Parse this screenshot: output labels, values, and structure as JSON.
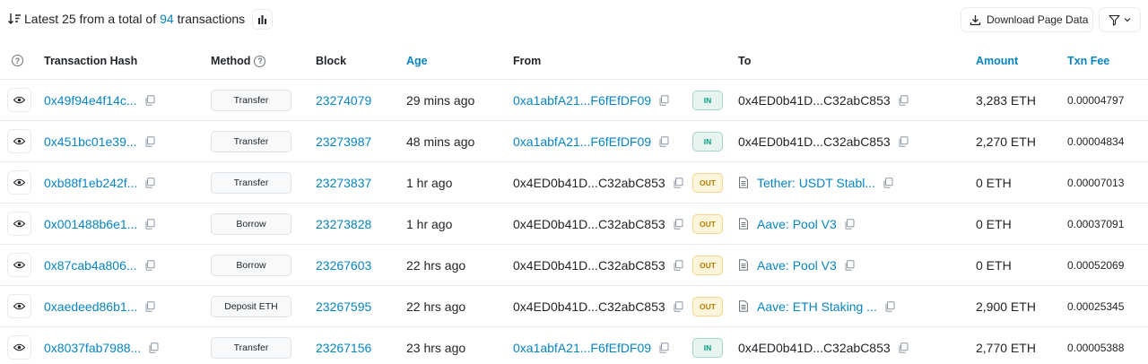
{
  "summary": {
    "prefix": "Latest 25 from a total of",
    "count": "94",
    "suffix": "transactions"
  },
  "toolbar": {
    "download_label": "Download Page Data"
  },
  "columns": {
    "hash": "Transaction Hash",
    "method": "Method",
    "block": "Block",
    "age": "Age",
    "from": "From",
    "to": "To",
    "amount": "Amount",
    "fee": "Txn Fee"
  },
  "colors": {
    "link": "#0784c3",
    "in_bg": "#e8f4ef",
    "in_text": "#00a186",
    "out_bg": "#fdf4dc",
    "out_text": "#b47d00"
  },
  "rows": [
    {
      "hash": "0x49f94e4f14c...",
      "method": "Transfer",
      "block": "23274079",
      "age": "29 mins ago",
      "from": "0xa1abfA21...F6fEfDF09",
      "from_link": true,
      "dir": "IN",
      "to": "0x4ED0b41D...C32abC853",
      "to_contract": false,
      "amount": "3,283 ETH",
      "fee": "0.00004797"
    },
    {
      "hash": "0x451bc01e39...",
      "method": "Transfer",
      "block": "23273987",
      "age": "48 mins ago",
      "from": "0xa1abfA21...F6fEfDF09",
      "from_link": true,
      "dir": "IN",
      "to": "0x4ED0b41D...C32abC853",
      "to_contract": false,
      "amount": "2,270 ETH",
      "fee": "0.00004834"
    },
    {
      "hash": "0xb88f1eb242f...",
      "method": "Transfer",
      "block": "23273837",
      "age": "1 hr ago",
      "from": "0x4ED0b41D...C32abC853",
      "from_link": false,
      "dir": "OUT",
      "to": "Tether: USDT Stabl...",
      "to_contract": true,
      "amount": "0 ETH",
      "fee": "0.00007013"
    },
    {
      "hash": "0x001488b6e1...",
      "method": "Borrow",
      "block": "23273828",
      "age": "1 hr ago",
      "from": "0x4ED0b41D...C32abC853",
      "from_link": false,
      "dir": "OUT",
      "to": "Aave: Pool V3",
      "to_contract": true,
      "amount": "0 ETH",
      "fee": "0.00037091"
    },
    {
      "hash": "0x87cab4a806...",
      "method": "Borrow",
      "block": "23267603",
      "age": "22 hrs ago",
      "from": "0x4ED0b41D...C32abC853",
      "from_link": false,
      "dir": "OUT",
      "to": "Aave: Pool V3",
      "to_contract": true,
      "amount": "0 ETH",
      "fee": "0.00052069"
    },
    {
      "hash": "0xaedeed86b1...",
      "method": "Deposit ETH",
      "block": "23267595",
      "age": "22 hrs ago",
      "from": "0x4ED0b41D...C32abC853",
      "from_link": false,
      "dir": "OUT",
      "to": "Aave: ETH Staking ...",
      "to_contract": true,
      "amount": "2,900 ETH",
      "fee": "0.00025345"
    },
    {
      "hash": "0x8037fab7988...",
      "method": "Transfer",
      "block": "23267156",
      "age": "23 hrs ago",
      "from": "0xa1abfA21...F6fEfDF09",
      "from_link": true,
      "dir": "IN",
      "to": "0x4ED0b41D...C32abC853",
      "to_contract": false,
      "amount": "2,770 ETH",
      "fee": "0.00005388"
    }
  ]
}
